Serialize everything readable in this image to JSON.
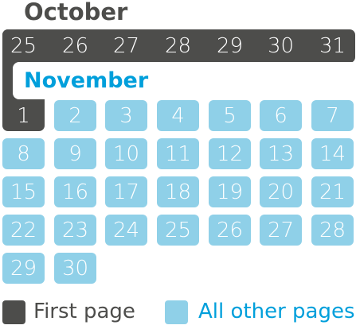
{
  "october": {
    "title": "October",
    "days": [
      "25",
      "26",
      "27",
      "28",
      "29",
      "30",
      "31"
    ]
  },
  "november": {
    "title": "November",
    "days": [
      "1",
      "2",
      "3",
      "4",
      "5",
      "6",
      "7",
      "8",
      "9",
      "10",
      "11",
      "12",
      "13",
      "14",
      "15",
      "16",
      "17",
      "18",
      "19",
      "20",
      "21",
      "22",
      "23",
      "24",
      "25",
      "26",
      "27",
      "28",
      "29",
      "30"
    ]
  },
  "legend": {
    "first_page": "First page",
    "other_pages": "All other pages"
  },
  "colors": {
    "first_page": "#4d4d4b",
    "other_pages": "#8fd0e8",
    "accent_text": "#009fdb"
  }
}
